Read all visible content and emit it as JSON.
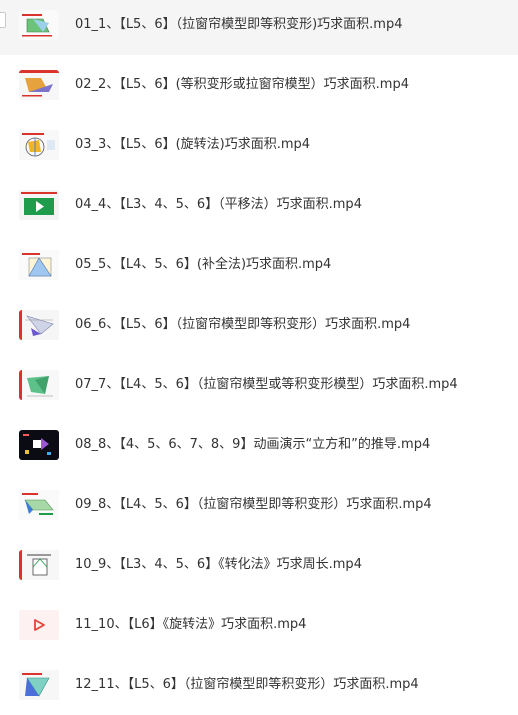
{
  "files": [
    {
      "name": "01_1、【L5、6】（拉窗帘模型即等积变形)巧求面积.mp4",
      "thumb": "video-thumbnail-geometry",
      "hovered": true
    },
    {
      "name": "02_2、【L5、6】(等积变形或拉窗帘模型）巧求面积.mp4",
      "thumb": "video-thumbnail-geometry"
    },
    {
      "name": "03_3、【L5、6】(旋转法)巧求面积.mp4",
      "thumb": "video-thumbnail-geometry"
    },
    {
      "name": "04_4、【L3、4、5、6】（平移法）巧求面积.mp4",
      "thumb": "video-thumbnail-green-play"
    },
    {
      "name": "05_5、【L4、5、6】(补全法)巧求面积.mp4",
      "thumb": "video-thumbnail-geometry"
    },
    {
      "name": "06_6、【L5、6】（拉窗帘模型即等积变形）巧求面积.mp4",
      "thumb": "video-thumbnail-geometry"
    },
    {
      "name": "07_7、【L4、5、6】（拉窗帘模型或等积变形模型）巧求面积.mp4",
      "thumb": "video-thumbnail-geometry"
    },
    {
      "name": "08_8、【4、5、6、7、8、9】动画演示“立方和”的推导.mp4",
      "thumb": "video-thumbnail-dark-animation"
    },
    {
      "name": "09_8、【L4、5、6】（拉窗帘模型即等积变形）巧求面积.mp4",
      "thumb": "video-thumbnail-geometry"
    },
    {
      "name": "10_9、【L3、4、5、6】《转化法》巧求周长.mp4",
      "thumb": "video-thumbnail-geometry"
    },
    {
      "name": "11_10、【L6】《旋转法》巧求面积.mp4",
      "thumb": "video-play-icon"
    },
    {
      "name": "12_11、【L5、6】（拉窗帘模型即等积变形）巧求面积.mp4",
      "thumb": "video-thumbnail-geometry"
    }
  ],
  "colors": {
    "hover_bg": "#f5f5f6",
    "text": "#333333",
    "thumb_accent_red": "#d9332c",
    "thumb_accent_green": "#1f9c4b",
    "play_icon_red": "#e8403c"
  }
}
